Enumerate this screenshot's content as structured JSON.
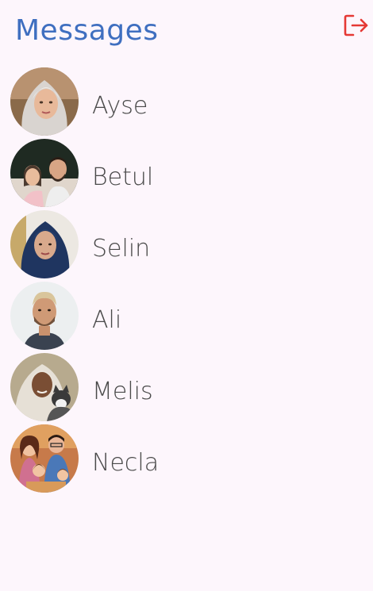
{
  "header": {
    "title": "Messages",
    "logout_icon": "logout-icon",
    "accent_color": "#3f6fc0",
    "logout_color": "#e53935"
  },
  "contacts": [
    {
      "name": "Ayse"
    },
    {
      "name": "Betul"
    },
    {
      "name": "Selin"
    },
    {
      "name": "Ali"
    },
    {
      "name": "Melis"
    },
    {
      "name": "Necla"
    }
  ]
}
